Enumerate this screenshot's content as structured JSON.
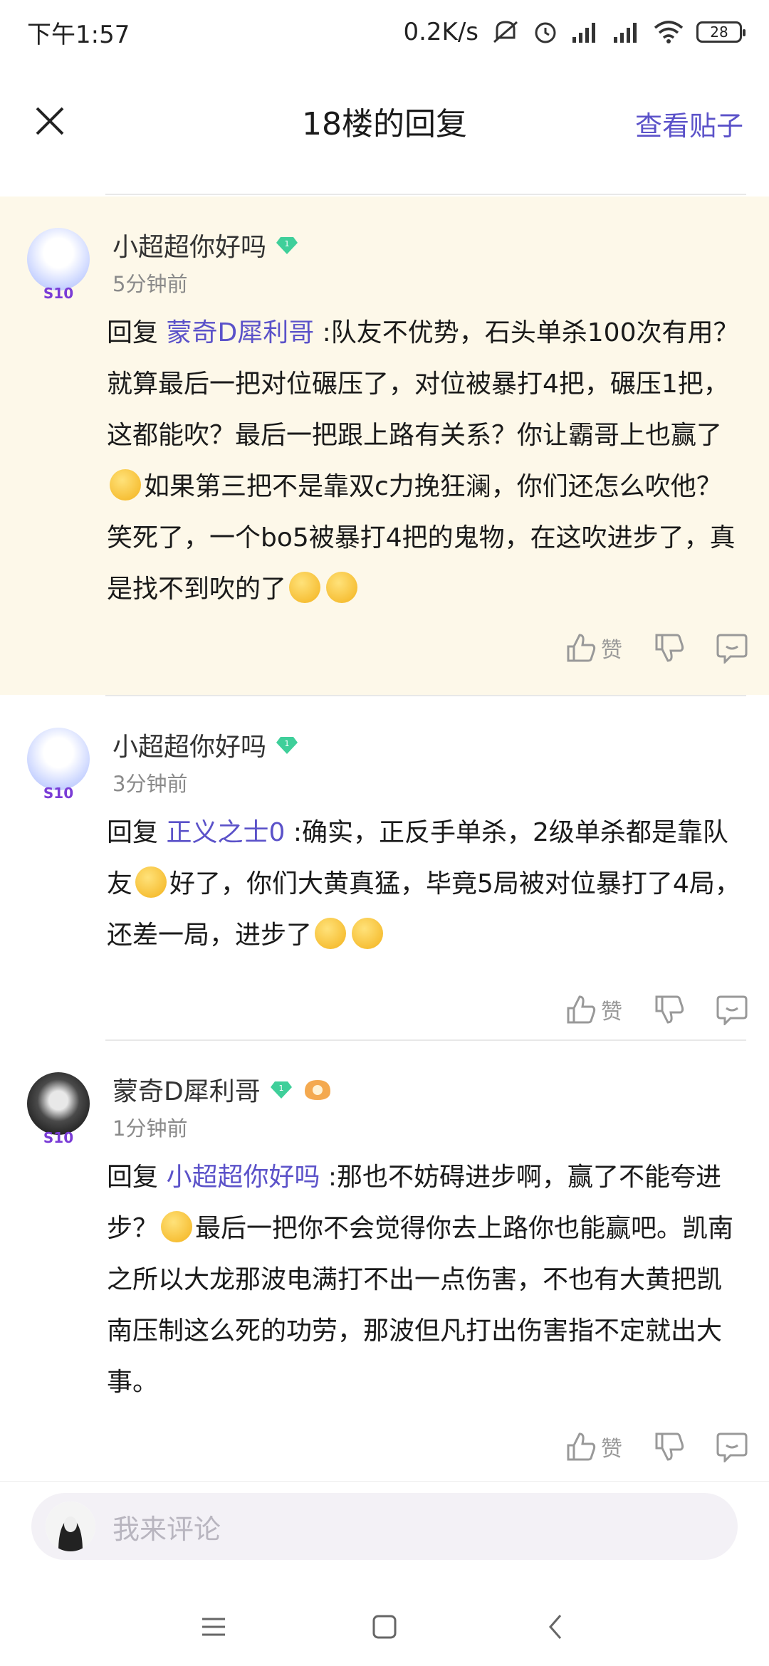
{
  "status_bar": {
    "time": "下午1:57",
    "network_speed": "0.2K/s",
    "battery": "28"
  },
  "header": {
    "title": "18楼的回复",
    "view_post": "查看贴子"
  },
  "replies": [
    {
      "username": "小超超你好吗",
      "level": "1",
      "badge": "S10",
      "time": "5分钟前",
      "prefix": "回复",
      "mention": "蒙奇D犀利哥",
      "text1": " :队友不优势，石头单杀100次有用？就算最后一把对位碾压了，对位被暴打4把，碾压1把，这都能吹？最后一把跟上路有关系？你让霸哥上也赢了",
      "text2": "如果第三把不是靠双c力挽狂澜，你们还怎么吹他？笑死了，一个bo5被暴打4把的鬼物，在这吹进步了，真是找不到吹的了",
      "like_label": "赞"
    },
    {
      "username": "小超超你好吗",
      "level": "1",
      "badge": "S10",
      "time": "3分钟前",
      "prefix": "回复",
      "mention": "正义之士0",
      "text1": " :确实，正反手单杀，2级单杀都是靠队友",
      "text2": "好了，你们大黄真猛，毕竟5局被对位暴打了4局，还差一局，进步了",
      "like_label": "赞"
    },
    {
      "username": "蒙奇D犀利哥",
      "level": "1",
      "badge": "S10",
      "time": "1分钟前",
      "prefix": "回复",
      "mention": "小超超你好吗",
      "text1": " :那也不妨碍进步啊，赢了不能夸进步？",
      "text2": "最后一把你不会觉得你去上路你也能赢吧。凯南之所以大龙那波电满打不出一点伤害，不也有大黄把凯南压制这么死的功劳，那波但凡打出伤害指不定就出大事。",
      "like_label": "赞"
    }
  ],
  "comment_bar": {
    "placeholder": "我来评论"
  }
}
